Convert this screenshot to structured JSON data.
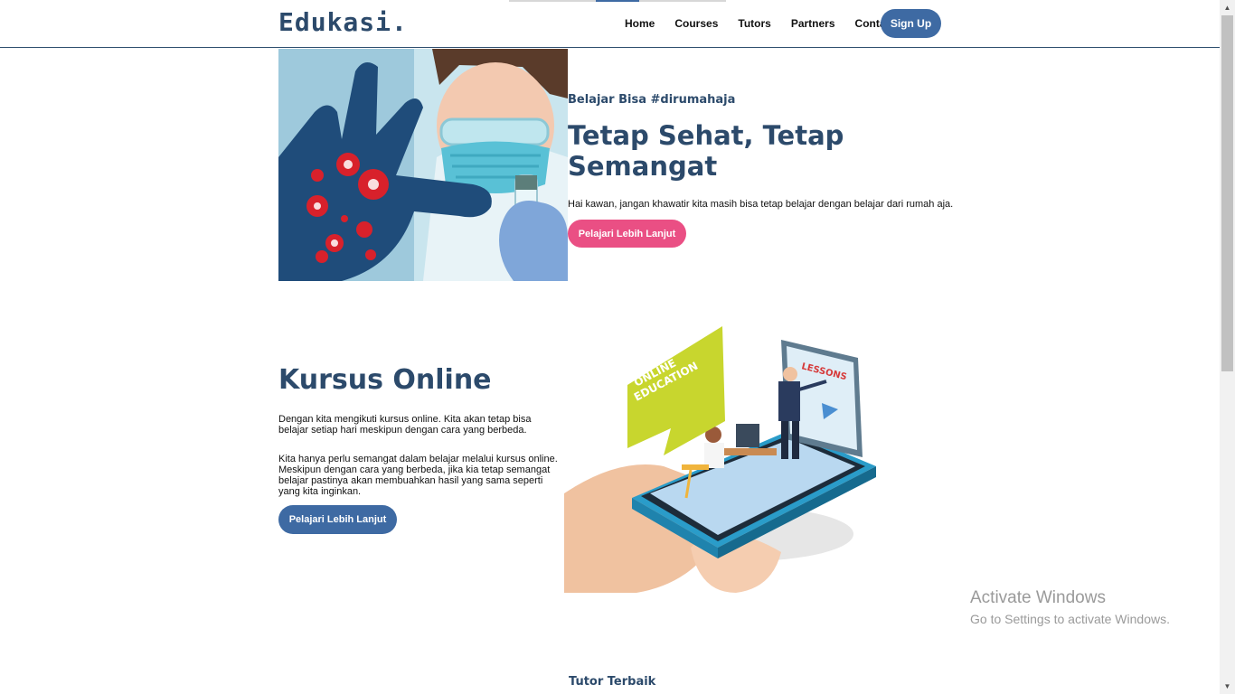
{
  "header": {
    "logo": "Edukasi.",
    "nav": [
      "Home",
      "Courses",
      "Tutors",
      "Partners",
      "Contact"
    ],
    "signup": "Sign Up"
  },
  "hero": {
    "eyebrow": "Belajar Bisa #dirumahaja",
    "title": "Tetap Sehat, Tetap Semangat",
    "description": "Hai kawan, jangan khawatir kita masih bisa tetap belajar dengan belajar dari rumah aja.",
    "cta": "Pelajari Lebih Lanjut"
  },
  "kursus": {
    "title": "Kursus Online",
    "p1": "Dengan kita mengikuti kursus online. Kita akan tetap bisa belajar setiap hari meskipun dengan cara yang berbeda.",
    "p2": "Kita hanya perlu semangat dalam belajar melalui kursus online. Meskipun dengan cara yang berbeda, jika kia tetap semangat belajar pastinya akan membuahkan hasil yang sama seperti yang kita inginkan.",
    "cta": "Pelajari Lebih Lanjut",
    "bubble_line1": "ONLINE",
    "bubble_line2": "EDUCATION",
    "screen_label": "LESSONS"
  },
  "tutor": {
    "heading": "Tutor Terbaik"
  },
  "watermark": {
    "title": "Activate Windows",
    "subtitle": "Go to Settings to activate Windows."
  },
  "colors": {
    "primary": "#3e6aa3",
    "accent": "#ea4f84",
    "heading": "#2c4a6b"
  },
  "icons": {
    "scroll_up": "scroll-up-arrow-icon",
    "scroll_down": "scroll-down-arrow-icon"
  }
}
